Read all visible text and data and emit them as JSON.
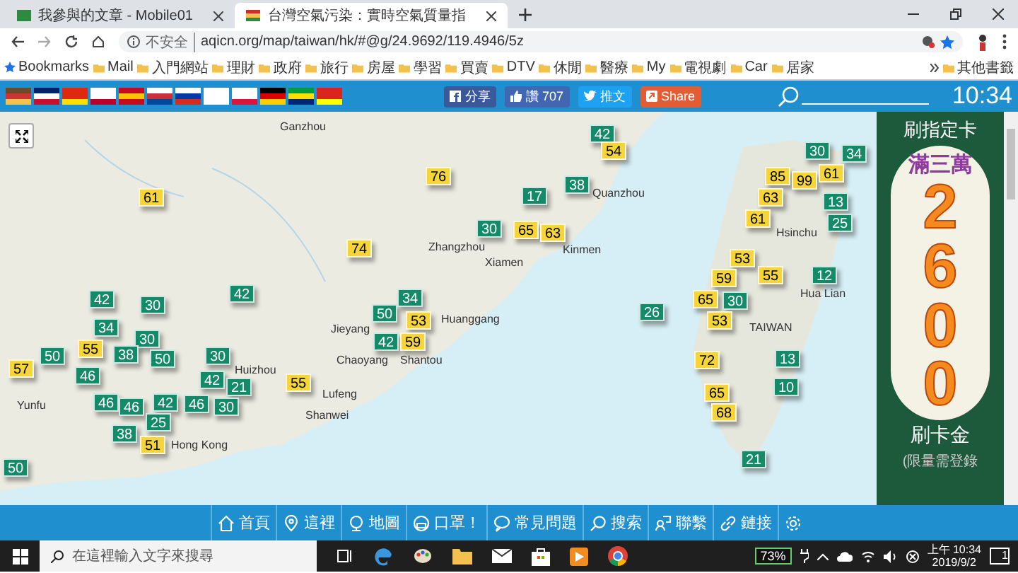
{
  "browser": {
    "tabs": [
      {
        "title": "我參與的文章 - Mobile01",
        "selected": false
      },
      {
        "title": "台灣空氣污染：實時空氣質量指",
        "selected": true
      }
    ],
    "address": {
      "security": "不安全",
      "url": "aqicn.org/map/taiwan/hk/#@g/24.9692/119.4946/5z"
    },
    "bookmarks_label": "Bookmarks",
    "bookmarks": [
      "Mail",
      "入門網站",
      "理財",
      "政府",
      "旅行",
      "房屋",
      "學習",
      "買賣",
      "DTV",
      "休閒",
      "醫療",
      "My",
      "電視劇",
      "Car",
      "居家"
    ],
    "other_bookmarks": "其他書籤"
  },
  "toolbar": {
    "share_buttons": [
      {
        "kind": "facebook",
        "label": "分享"
      },
      {
        "kind": "like",
        "label": "讚 707"
      },
      {
        "kind": "twitter",
        "label": "推文"
      },
      {
        "kind": "share",
        "label": "Share"
      }
    ],
    "time": "10:34"
  },
  "map": {
    "markers": [
      {
        "value": "61",
        "color": "#f5d53a"
      },
      {
        "value": "76",
        "color": "#f5d53a"
      },
      {
        "value": "74",
        "color": "#f5d53a"
      },
      {
        "value": "30",
        "color": "#158a68"
      },
      {
        "value": "42",
        "color": "#158a68"
      },
      {
        "value": "54",
        "color": "#f5d53a"
      },
      {
        "value": "38",
        "color": "#158a68"
      },
      {
        "value": "17",
        "color": "#158a68"
      },
      {
        "value": "65",
        "color": "#f5d53a"
      },
      {
        "value": "63",
        "color": "#f5d53a"
      },
      {
        "value": "42",
        "color": "#158a68"
      },
      {
        "value": "30",
        "color": "#158a68"
      },
      {
        "value": "42",
        "color": "#158a68"
      },
      {
        "value": "34",
        "color": "#158a68"
      },
      {
        "value": "30",
        "color": "#158a68"
      },
      {
        "value": "55",
        "color": "#f5d53a"
      },
      {
        "value": "50",
        "color": "#158a68"
      },
      {
        "value": "57",
        "color": "#f5d53a"
      },
      {
        "value": "38",
        "color": "#158a68"
      },
      {
        "value": "50",
        "color": "#158a68"
      },
      {
        "value": "46",
        "color": "#158a68"
      },
      {
        "value": "30",
        "color": "#158a68"
      },
      {
        "value": "42",
        "color": "#158a68"
      },
      {
        "value": "21",
        "color": "#158a68"
      },
      {
        "value": "55",
        "color": "#f5d53a"
      },
      {
        "value": "46",
        "color": "#158a68"
      },
      {
        "value": "46",
        "color": "#158a68"
      },
      {
        "value": "42",
        "color": "#158a68"
      },
      {
        "value": "46",
        "color": "#158a68"
      },
      {
        "value": "30",
        "color": "#158a68"
      },
      {
        "value": "25",
        "color": "#158a68"
      },
      {
        "value": "38",
        "color": "#158a68"
      },
      {
        "value": "51",
        "color": "#f5d53a"
      },
      {
        "value": "50",
        "color": "#158a68"
      },
      {
        "value": "50",
        "color": "#158a68"
      },
      {
        "value": "34",
        "color": "#158a68"
      },
      {
        "value": "53",
        "color": "#f5d53a"
      },
      {
        "value": "42",
        "color": "#158a68"
      },
      {
        "value": "59",
        "color": "#f5d53a"
      },
      {
        "value": "30",
        "color": "#158a68"
      },
      {
        "value": "34",
        "color": "#158a68"
      },
      {
        "value": "85",
        "color": "#f5d53a"
      },
      {
        "value": "99",
        "color": "#f5d53a"
      },
      {
        "value": "61",
        "color": "#f5d53a"
      },
      {
        "value": "63",
        "color": "#f5d53a"
      },
      {
        "value": "13",
        "color": "#158a68"
      },
      {
        "value": "61",
        "color": "#f5d53a"
      },
      {
        "value": "25",
        "color": "#158a68"
      },
      {
        "value": "53",
        "color": "#f5d53a"
      },
      {
        "value": "59",
        "color": "#f5d53a"
      },
      {
        "value": "55",
        "color": "#f5d53a"
      },
      {
        "value": "12",
        "color": "#158a68"
      },
      {
        "value": "65",
        "color": "#f5d53a"
      },
      {
        "value": "30",
        "color": "#158a68"
      },
      {
        "value": "53",
        "color": "#f5d53a"
      },
      {
        "value": "26",
        "color": "#158a68"
      },
      {
        "value": "72",
        "color": "#f5d53a"
      },
      {
        "value": "13",
        "color": "#158a68"
      },
      {
        "value": "10",
        "color": "#158a68"
      },
      {
        "value": "65",
        "color": "#f5d53a"
      },
      {
        "value": "68",
        "color": "#f5d53a"
      },
      {
        "value": "21",
        "color": "#158a68"
      }
    ],
    "places": [
      "Ganzhou",
      "Zhangzhou",
      "Xiamen",
      "Kinmen",
      "Quanzhou",
      "Huanggang",
      "Jieyang",
      "Chaoyang",
      "Shantou",
      "Huizhou",
      "Lufeng",
      "Shanwei",
      "Yunfu",
      "Hong Kong",
      "Hsinchu",
      "Hua Lian",
      "TAIWAN"
    ]
  },
  "ad": {
    "headline": "刷指定卡",
    "offer": "滿三萬",
    "amount": "2600",
    "reward": "刷卡金",
    "note": "(限量需登錄"
  },
  "nav": [
    {
      "kind": "home",
      "label": "首頁"
    },
    {
      "kind": "pin",
      "label": "這裡"
    },
    {
      "kind": "globe",
      "label": "地圖"
    },
    {
      "kind": "mask",
      "label": "口罩！"
    },
    {
      "kind": "faq",
      "label": "常見問題"
    },
    {
      "kind": "search",
      "label": "搜索"
    },
    {
      "kind": "contact",
      "label": "聯繫"
    },
    {
      "kind": "link",
      "label": "鏈接"
    },
    {
      "kind": "settings"
    }
  ],
  "taskbar": {
    "search_placeholder": "在這裡輸入文字來搜尋",
    "battery": "73%",
    "time": "上午 10:34",
    "date": "2019/9/2",
    "notifications": "1"
  }
}
